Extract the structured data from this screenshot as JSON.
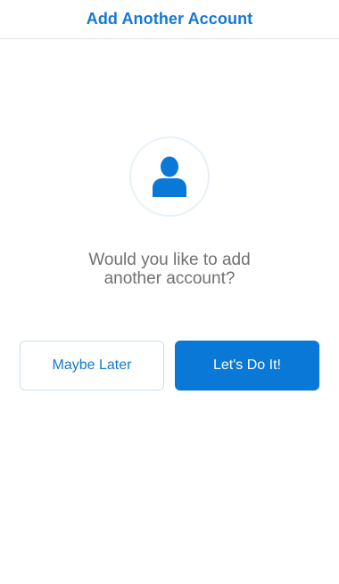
{
  "header": {
    "title": "Add Another Account"
  },
  "main": {
    "avatar_icon": "person-icon",
    "prompt": "Would you like to add\nanother account?",
    "maybe_later_label": "Maybe Later",
    "confirm_label": "Let's Do It!"
  },
  "colors": {
    "accent": "#1478d2",
    "primary_button": "#0a78d7",
    "prompt_text": "#707070",
    "divider": "#e3e3e3"
  }
}
